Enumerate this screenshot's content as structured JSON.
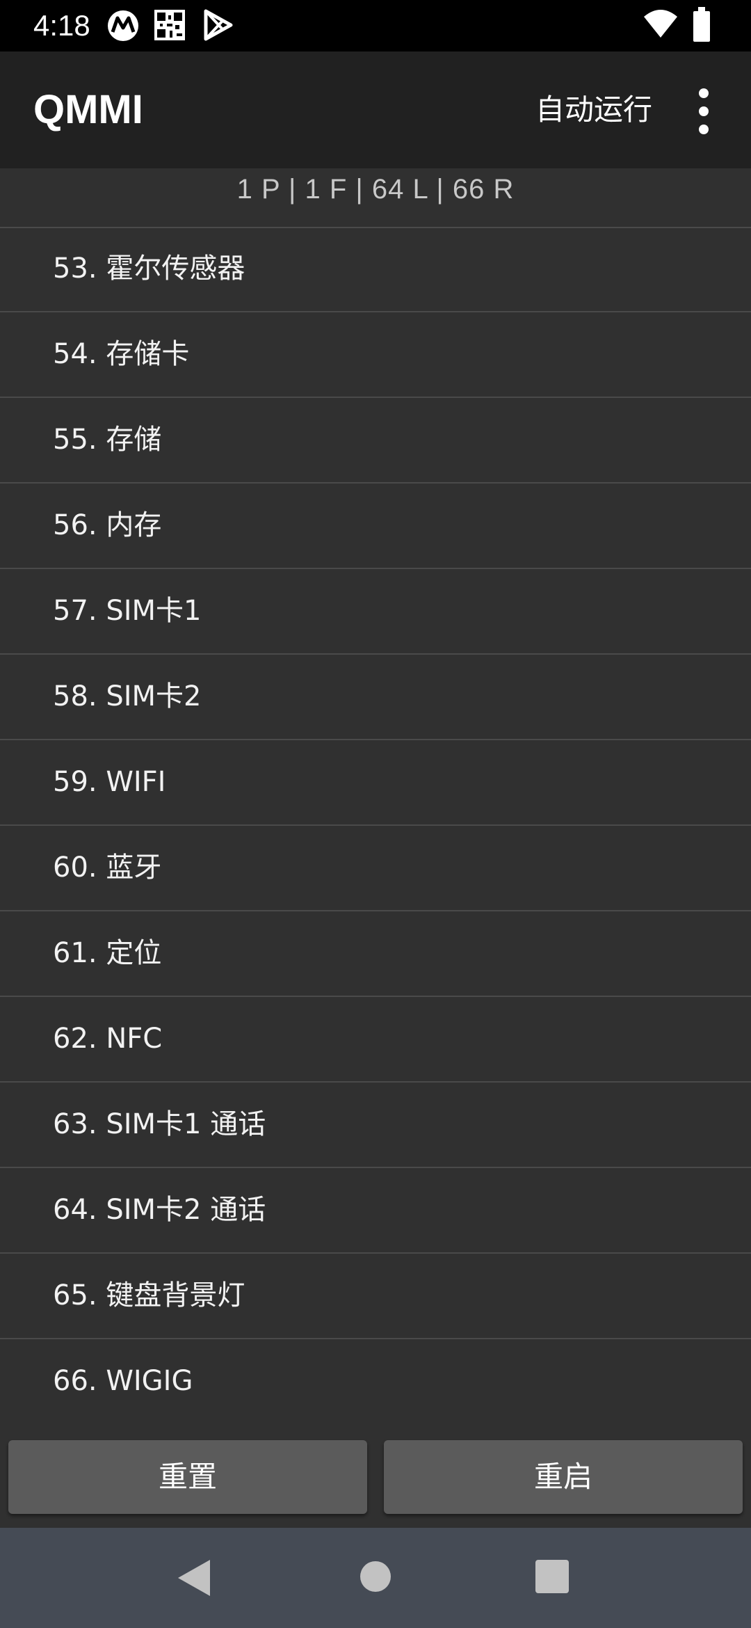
{
  "status_bar": {
    "time": "4:18",
    "icons": [
      "motorola-icon",
      "qr-code-icon",
      "play-store-icon",
      "wifi-icon",
      "battery-icon"
    ]
  },
  "app_bar": {
    "title": "QMMI",
    "auto_run_label": "自动运行",
    "overflow_icon": "more-vert-icon"
  },
  "summary": "1 P | 1 F  | 64 L | 66 R",
  "list": {
    "items": [
      {
        "label": "53. 霍尔传感器"
      },
      {
        "label": "54. 存储卡"
      },
      {
        "label": "55. 存储"
      },
      {
        "label": "56. 内存"
      },
      {
        "label": "57. SIM卡1"
      },
      {
        "label": "58. SIM卡2"
      },
      {
        "label": "59. WIFI"
      },
      {
        "label": "60. 蓝牙"
      },
      {
        "label": "61. 定位"
      },
      {
        "label": "62. NFC"
      },
      {
        "label": "63. SIM卡1 通话"
      },
      {
        "label": "64. SIM卡2 通话"
      },
      {
        "label": "65. 键盘背景灯"
      },
      {
        "label": "66. WIGIG"
      }
    ]
  },
  "buttons": {
    "reset_label": "重置",
    "restart_label": "重启"
  },
  "nav_bar": {
    "icons": [
      "back-icon",
      "home-icon",
      "recents-icon"
    ]
  },
  "colors": {
    "background": "#303030",
    "app_bar": "#212121",
    "status_bar": "#000000",
    "button": "#5b5b5b",
    "nav_bar": "#454b55",
    "divider": "#4a4a4a"
  }
}
